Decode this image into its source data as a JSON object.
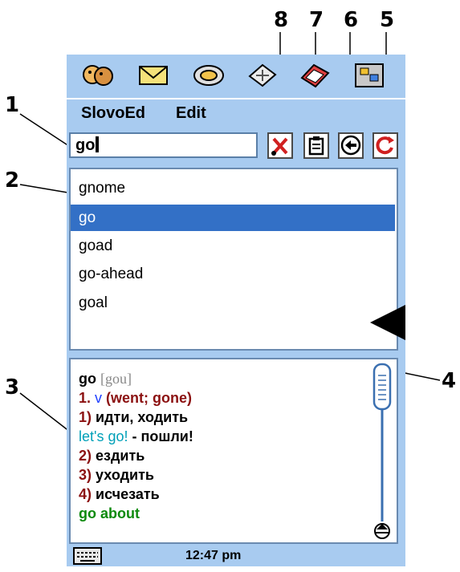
{
  "callouts": [
    "1",
    "2",
    "3",
    "4",
    "5",
    "6",
    "7",
    "8"
  ],
  "toolbar_icons": [
    "contacts-icon",
    "mail-icon",
    "sync-icon",
    "calculator-icon",
    "notes-icon",
    "apps-icon"
  ],
  "menu": {
    "items": [
      "SlovoEd",
      "Edit"
    ]
  },
  "search": {
    "value": "go"
  },
  "actions": [
    "cut-icon",
    "paste-icon",
    "back-icon",
    "refresh-icon"
  ],
  "wordlist": {
    "items": [
      "gnome",
      "go",
      "goad",
      "go-ahead",
      "goal"
    ],
    "selected": "go"
  },
  "article": {
    "headword": "go",
    "transcription": "[gou]",
    "sense1_num": "1.",
    "sense1_pos": "v",
    "sense1_forms": "(went; gone)",
    "entries": [
      {
        "num": "1)",
        "text": "идти, ходить"
      },
      {
        "num": "2)",
        "text": "ездить"
      },
      {
        "num": "3)",
        "text": "уходить"
      },
      {
        "num": "4)",
        "text": "исчезать"
      }
    ],
    "example": "let's go!",
    "example_sep": " - ",
    "example_translation": "пошли!",
    "phrase": "go about"
  },
  "status": {
    "time": "12:47 pm"
  },
  "colors": {
    "chrome": "#a8cbf0",
    "selection": "#3370c6",
    "accent_red": "#8b1010",
    "phrase_green": "#0d8a0d"
  }
}
